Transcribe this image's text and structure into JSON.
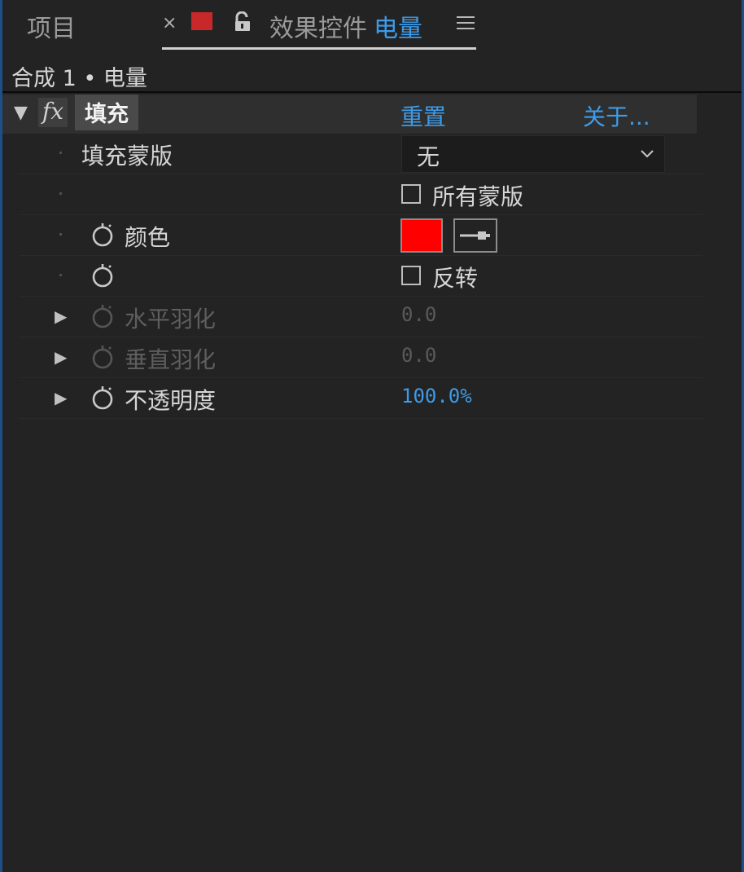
{
  "tabs": {
    "project_label": "项目",
    "close_label": "×",
    "panel_title": "效果控件",
    "comp_name": "电量",
    "accent_color": "#3d9be9",
    "label_color_swatch": "#c8282a"
  },
  "breadcrumb": "合成 1 • 电量",
  "effect": {
    "name": "填充",
    "reset_label": "重置",
    "about_label": "关于..."
  },
  "properties": {
    "fill_mask": {
      "label": "填充蒙版",
      "value": "无"
    },
    "all_masks": {
      "label": "所有蒙版",
      "checked": false
    },
    "color": {
      "label": "颜色",
      "value": "#ff0000"
    },
    "invert": {
      "label": "反转",
      "checked": false
    },
    "horizontal_feather": {
      "label": "水平羽化",
      "value": "0.0"
    },
    "vertical_feather": {
      "label": "垂直羽化",
      "value": "0.0"
    },
    "opacity": {
      "label": "不透明度",
      "value": "100.0%"
    }
  }
}
